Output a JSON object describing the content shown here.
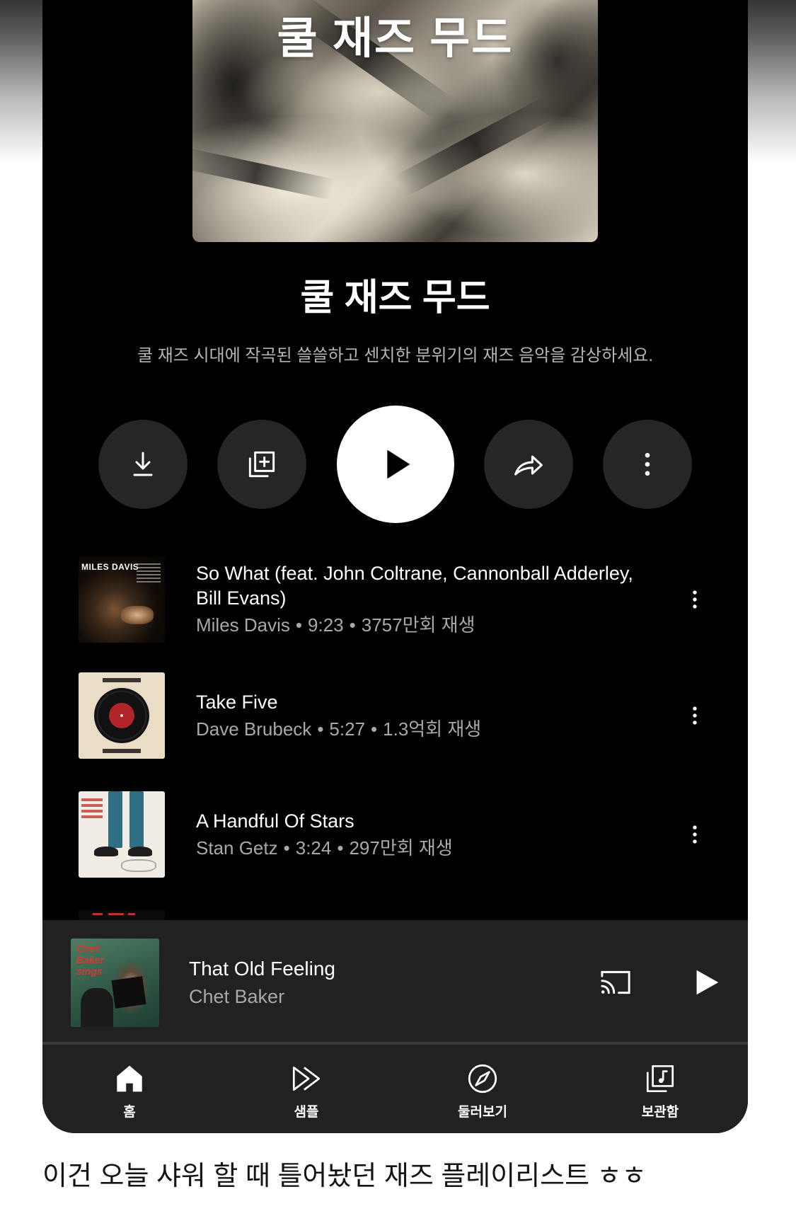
{
  "playlist": {
    "cover_text": "쿨 재즈 무드",
    "title": "쿨 재즈 무드",
    "description": "쿨 재즈 시대에 작곡된 쓸쓸하고 센치한 분위기의 재즈 음악을 감상하세요."
  },
  "actions": [
    {
      "icon": "download-icon"
    },
    {
      "icon": "add-to-library-icon"
    },
    {
      "icon": "play-icon"
    },
    {
      "icon": "share-icon"
    },
    {
      "icon": "more-vert-icon"
    }
  ],
  "meta_separator": "•",
  "tracks": [
    {
      "title": "So What (feat. John Coltrane, Cannonball Adderley, Bill Evans)",
      "artist": "Miles Davis",
      "duration": "9:23",
      "plays": "3757만회 재생",
      "cover_text": "MILES DAVIS"
    },
    {
      "title": "Take Five",
      "artist": "Dave Brubeck",
      "duration": "5:27",
      "plays": "1.3억회 재생"
    },
    {
      "title": "A Handful Of Stars",
      "artist": "Stan Getz",
      "duration": "3:24",
      "plays": "297만회 재생"
    }
  ],
  "now_playing": {
    "title": "That Old Feeling",
    "artist": "Chet Baker",
    "cover_text": "Chet Baker sings",
    "cast_icon": "cast-icon",
    "play_icon": "play-icon"
  },
  "bottom_nav": [
    {
      "label": "홈",
      "icon": "home-icon",
      "active": true
    },
    {
      "label": "샘플",
      "icon": "samples-icon",
      "active": false
    },
    {
      "label": "둘러보기",
      "icon": "explore-icon",
      "active": false
    },
    {
      "label": "보관함",
      "icon": "library-icon",
      "active": false
    }
  ],
  "caption": "이건 오늘 샤워 할 때 틀어놨던 재즈 플레이리스트 ㅎㅎ",
  "colors": {
    "background": "#000000",
    "surface": "#212121",
    "action_button": "#262626",
    "text_primary": "#ffffff",
    "text_secondary": "#a9a9a9",
    "page_background": "#ffffff"
  }
}
